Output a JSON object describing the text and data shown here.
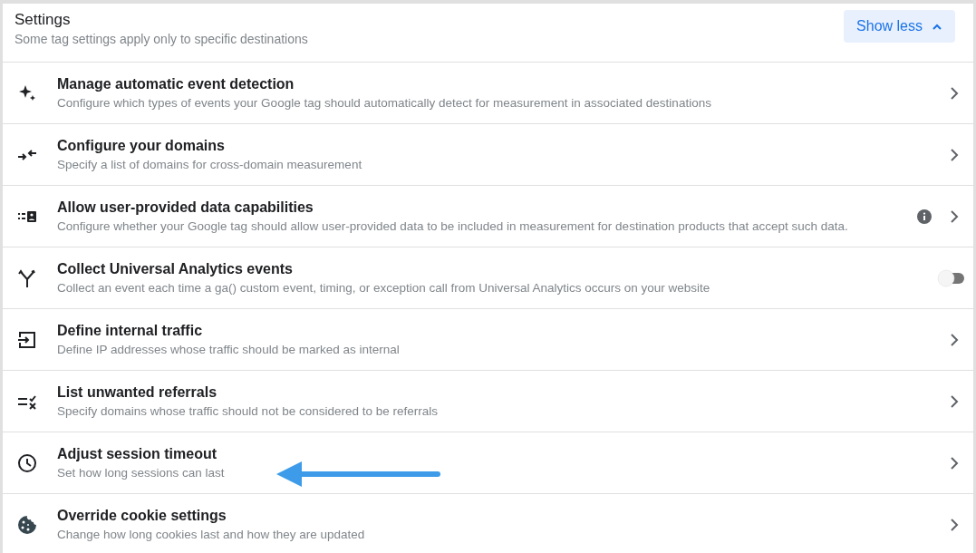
{
  "header": {
    "title": "Settings",
    "subtitle": "Some tag settings apply only to specific destinations",
    "button": "Show less",
    "expanded": true
  },
  "settings": [
    {
      "title": "Manage automatic event detection",
      "description": "Configure which types of events your Google tag should automatically detect for measurement in associated destinations",
      "kind": "link",
      "info": false
    },
    {
      "title": "Configure your domains",
      "description": "Specify a list of domains for cross-domain measurement",
      "kind": "link",
      "info": false
    },
    {
      "title": "Allow user-provided data capabilities",
      "description": "Configure whether your Google tag should allow user-provided data to be included in measurement for destination products that accept such data.",
      "kind": "link",
      "info": true
    },
    {
      "title": "Collect Universal Analytics events",
      "description": "Collect an event each time a ga() custom event, timing, or exception call from Universal Analytics occurs on your website",
      "kind": "toggle",
      "on": false,
      "info": false
    },
    {
      "title": "Define internal traffic",
      "description": "Define IP addresses whose traffic should be marked as internal",
      "kind": "link",
      "info": false
    },
    {
      "title": "List unwanted referrals",
      "description": "Specify domains whose traffic should not be considered to be referrals",
      "kind": "link",
      "info": false
    },
    {
      "title": "Adjust session timeout",
      "description": "Set how long sessions can last",
      "kind": "link",
      "info": false
    },
    {
      "title": "Override cookie settings",
      "description": "Change how long cookies last and how they are updated",
      "kind": "link",
      "info": false
    }
  ]
}
